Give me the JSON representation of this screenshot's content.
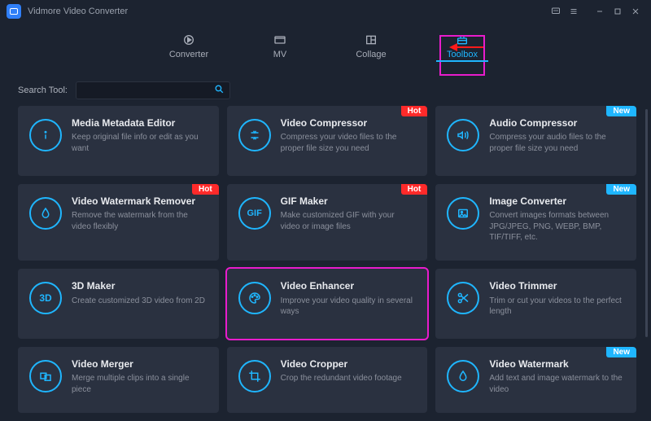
{
  "app": {
    "title": "Vidmore Video Converter"
  },
  "tabs": {
    "converter": "Converter",
    "mv": "MV",
    "collage": "Collage",
    "toolbox": "Toolbox"
  },
  "search": {
    "label": "Search Tool:",
    "value": ""
  },
  "badges": {
    "hot": "Hot",
    "new": "New"
  },
  "tools": {
    "metadata": {
      "title": "Media Metadata Editor",
      "desc": "Keep original file info or edit as you want"
    },
    "vcompress": {
      "title": "Video Compressor",
      "desc": "Compress your video files to the proper file size you need"
    },
    "acompress": {
      "title": "Audio Compressor",
      "desc": "Compress your audio files to the proper file size you need"
    },
    "watermark": {
      "title": "Video Watermark Remover",
      "desc": "Remove the watermark from the video flexibly"
    },
    "gif": {
      "title": "GIF Maker",
      "desc": "Make customized GIF with your video or image files"
    },
    "imgconv": {
      "title": "Image Converter",
      "desc": "Convert images formats between JPG/JPEG, PNG, WEBP, BMP, TIF/TIFF, etc."
    },
    "threeD": {
      "title": "3D Maker",
      "desc": "Create customized 3D video from 2D"
    },
    "enhancer": {
      "title": "Video Enhancer",
      "desc": "Improve your video quality in several ways"
    },
    "trimmer": {
      "title": "Video Trimmer",
      "desc": "Trim or cut your videos to the perfect length"
    },
    "merger": {
      "title": "Video Merger",
      "desc": "Merge multiple clips into a single piece"
    },
    "cropper": {
      "title": "Video Cropper",
      "desc": "Crop the redundant video footage"
    },
    "vwatermark": {
      "title": "Video Watermark",
      "desc": "Add text and image watermark to the video"
    }
  }
}
